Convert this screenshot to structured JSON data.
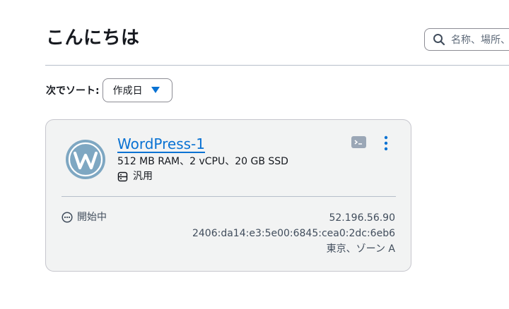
{
  "header": {
    "title": "こんにちは",
    "search_placeholder": "名称、場所、"
  },
  "sort": {
    "label": "次でソート:",
    "selected": "作成日"
  },
  "instance": {
    "name": "WordPress-1",
    "specs": "512 MB RAM、2 vCPU、20 GB SSD",
    "type": "汎用",
    "status": "開始中",
    "ipv4": "52.196.56.90",
    "ipv6": "2406:da14:e3:5e00:6845:cea0:2dc:6eb6",
    "location": "東京、ゾーン A"
  },
  "colors": {
    "accent": "#0972d3",
    "wordpress": "#7ea7c2",
    "card_bg": "#f2f3f3"
  },
  "icons": [
    "search-icon",
    "caret-down-icon",
    "wordpress-logo",
    "terminal-icon",
    "more-options-icon",
    "chip-icon",
    "pending-icon"
  ]
}
